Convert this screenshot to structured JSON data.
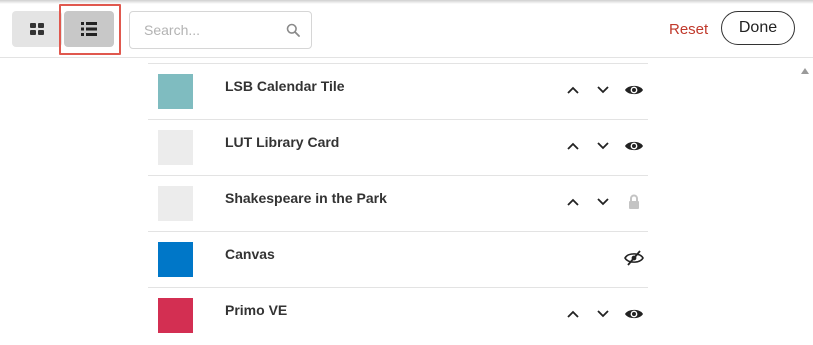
{
  "toolbar": {
    "grid_view": {
      "icon": "grid-icon"
    },
    "list_view": {
      "icon": "list-icon",
      "active": true
    },
    "search": {
      "placeholder": "Search...",
      "value": "",
      "icon": "search-icon"
    },
    "reset_label": "Reset",
    "done_label": "Done"
  },
  "colors": {
    "reset_text": "#c0392b",
    "highlight": "#e0584e"
  },
  "tiles": [
    {
      "title": "LSB Calendar Tile",
      "color": "#7fbcc0",
      "up": true,
      "down": true,
      "visibility_icon": "eye-icon"
    },
    {
      "title": "LUT Library Card",
      "color": "#ececec",
      "up": true,
      "down": true,
      "visibility_icon": "eye-icon"
    },
    {
      "title": "Shakespeare in the Park",
      "color": "#ececec",
      "up": true,
      "down": true,
      "visibility_icon": "lock-icon"
    },
    {
      "title": "Canvas",
      "color": "#0077c8",
      "up": false,
      "down": false,
      "visibility_icon": "eye-slash-icon"
    },
    {
      "title": "Primo VE",
      "color": "#d32f52",
      "up": true,
      "down": true,
      "visibility_icon": "eye-icon"
    }
  ]
}
